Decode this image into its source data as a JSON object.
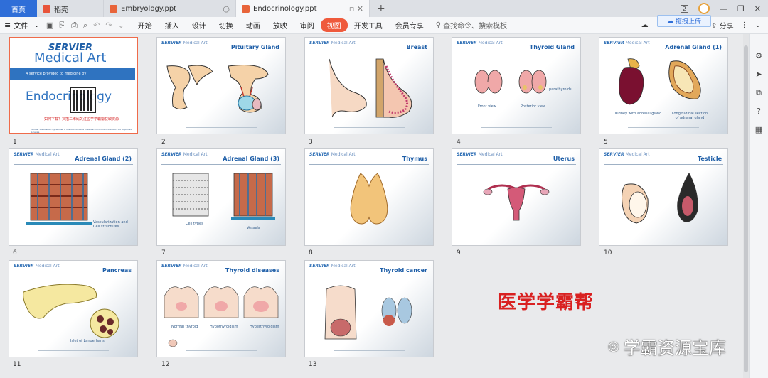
{
  "tabs": {
    "home": "首页",
    "items": [
      {
        "label": "稻壳",
        "color": "#e8543a"
      },
      {
        "label": "Embryology.ppt",
        "color": "#e8643a"
      },
      {
        "label": "Endocrinology.ppt",
        "color": "#e8643a"
      }
    ],
    "window_badge": "2"
  },
  "menu": {
    "file": "文件",
    "items": [
      "开始",
      "插入",
      "设计",
      "切换",
      "动画",
      "放映",
      "审阅",
      "视图",
      "开发工具",
      "会员专享"
    ],
    "active": "视图",
    "search_placeholder": "查找命令、搜索模板",
    "share": "分享",
    "upload_tip": "拖拽上传"
  },
  "slides": [
    {
      "n": "1",
      "title": "",
      "cover": {
        "brand": "SERVIER",
        "brand2": "Medical Art",
        "band": "A service provided to medicine by",
        "endo": "Endocrinology",
        "red": "如何下载？扫描二维码关注医学学霸帮获取资源",
        "foot": "Servier Medical Art by Servier is licensed under a Creative Commons Attribution 3.0 Unported License"
      }
    },
    {
      "n": "2",
      "title": "Pituitary Gland",
      "captions": []
    },
    {
      "n": "3",
      "title": "Breast",
      "captions": []
    },
    {
      "n": "4",
      "title": "Thyroid Gland",
      "captions": [
        "Front view",
        "Posterior view",
        "parathyroids"
      ]
    },
    {
      "n": "5",
      "title": "Adrenal Gland (1)",
      "captions": [
        "Kidney with adrenal gland",
        "Longitudinal section of adrenal gland"
      ]
    },
    {
      "n": "6",
      "title": "Adrenal Gland (2)",
      "captions": [
        "Vascularization and Cell structures"
      ]
    },
    {
      "n": "7",
      "title": "Adrenal Gland (3)",
      "captions": [
        "Cell types",
        "Vessels"
      ]
    },
    {
      "n": "8",
      "title": "Thymus",
      "captions": []
    },
    {
      "n": "9",
      "title": "Uterus",
      "captions": []
    },
    {
      "n": "10",
      "title": "Testicle",
      "captions": []
    },
    {
      "n": "11",
      "title": "Pancreas",
      "captions": [
        "Islet of Langerhans"
      ]
    },
    {
      "n": "12",
      "title": "Thyroid diseases",
      "captions": [
        "Normal thyroid",
        "Hypothyroidism",
        "Hyperthyroidism"
      ]
    },
    {
      "n": "13",
      "title": "Thyroid cancer",
      "captions": []
    }
  ],
  "brand": {
    "servier": "SERVIER",
    "medical": "Medical Art"
  },
  "watermarks": {
    "red": "医学学霸帮",
    "gray": "学霸资源宝库"
  },
  "colors": {
    "accent": "#ef5a3c",
    "tab_home": "#2f6ed8",
    "slide_title": "#1f5fa8"
  }
}
